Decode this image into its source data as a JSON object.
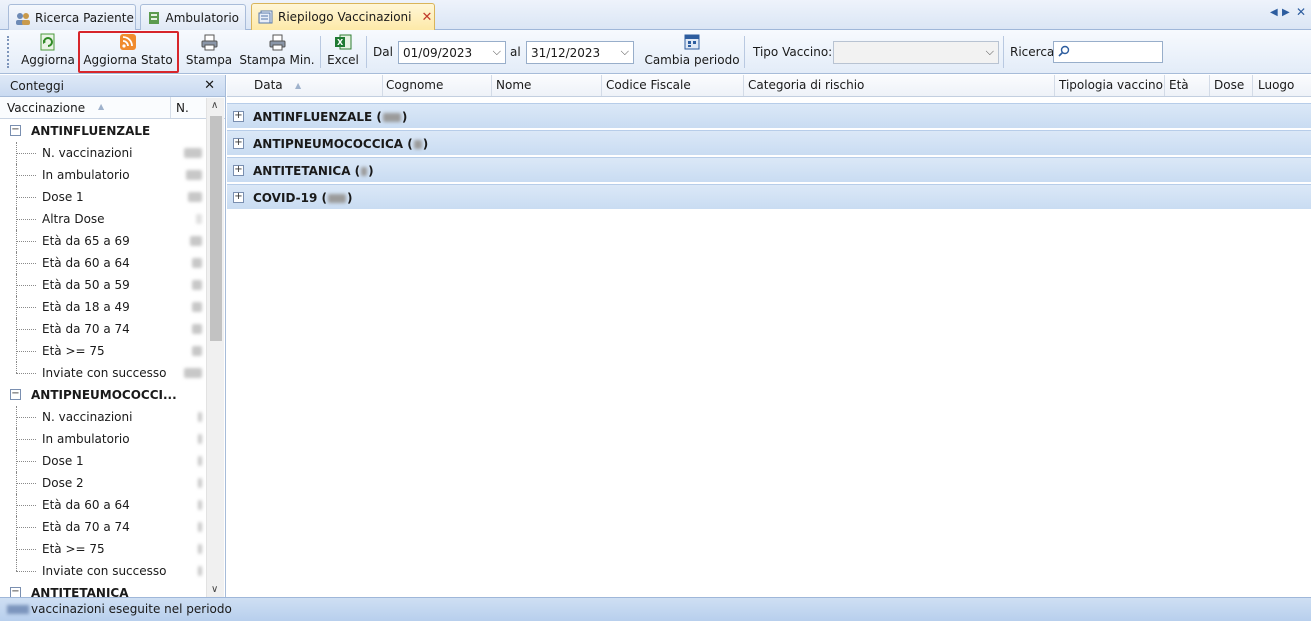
{
  "tabs": [
    {
      "label": "Ricerca Paziente",
      "icon": "patients-icon"
    },
    {
      "label": "Ambulatorio",
      "icon": "clinic-icon"
    },
    {
      "label": "Riepilogo Vaccinazioni",
      "icon": "report-icon",
      "active": true
    }
  ],
  "toolbar": {
    "aggiorna": "Aggiorna",
    "aggiorna_stato": "Aggiorna Stato",
    "stampa": "Stampa",
    "stampa_min": "Stampa Min.",
    "excel": "Excel",
    "dal_label": "Dal",
    "dal_value": "01/09/2023",
    "al_label": "al",
    "al_value": "31/12/2023",
    "cambia_periodo": "Cambia periodo",
    "tipo_vaccino_label": "Tipo Vaccino:",
    "tipo_vaccino_value": "",
    "ricerca_label": "Ricerca",
    "ricerca_value": ""
  },
  "left_panel": {
    "title": "Conteggi",
    "col_vaccinazione": "Vaccinazione",
    "col_n": "N.",
    "groups": [
      {
        "name": "ANTINFLUENZALE",
        "items": [
          "N. vaccinazioni",
          "In ambulatorio",
          "Dose 1",
          "Altra Dose",
          "Età da 65 a 69",
          "Età da 60 a 64",
          "Età da 50 a 59",
          "Età da 18 a 49",
          "Età da 70 a 74",
          "Età >= 75",
          "Inviate con successo"
        ]
      },
      {
        "name": "ANTIPNEUMOCOCCI...",
        "items": [
          "N. vaccinazioni",
          "In ambulatorio",
          "Dose 1",
          "Dose 2",
          "Età da 60 a 64",
          "Età da 70 a 74",
          "Età >= 75",
          "Inviate con successo"
        ]
      },
      {
        "name": "ANTITETANICA",
        "items": []
      }
    ]
  },
  "grid": {
    "columns": [
      "Data",
      "Cognome",
      "Nome",
      "Codice Fiscale",
      "Categoria di rischio",
      "Tipologia vaccino",
      "Età",
      "Dose",
      "Luogo"
    ],
    "groups": [
      {
        "name": "ANTINFLUENZALE (",
        "suffix": ")"
      },
      {
        "name": "ANTIPNEUMOCOCCICA (",
        "suffix": ")"
      },
      {
        "name": "ANTITETANICA (",
        "suffix": ")"
      },
      {
        "name": "COVID-19 (",
        "suffix": ")"
      }
    ]
  },
  "status": {
    "text": "vaccinazioni eseguite nel periodo"
  },
  "colors": {
    "accent": "#d7262b",
    "header_blue": "#c9dcf2",
    "active_tab": "#fde9a8"
  }
}
